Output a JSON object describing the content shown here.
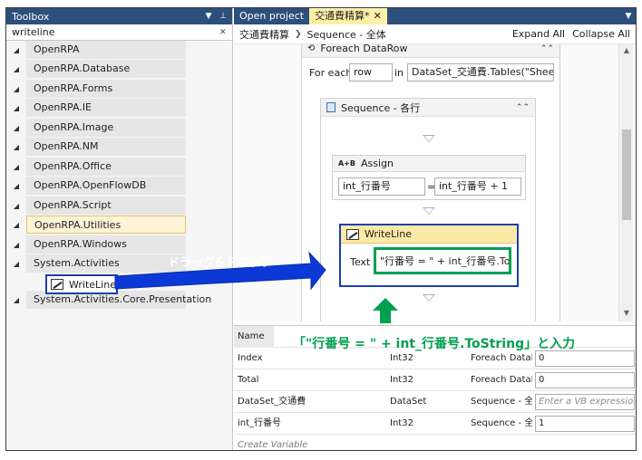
{
  "toolbox": {
    "title": "Toolbox",
    "pin": "▾ ⊥",
    "search_value": "writeline",
    "categories": [
      "OpenRPA",
      "OpenRPA.Database",
      "OpenRPA.Forms",
      "OpenRPA.IE",
      "OpenRPA.Image",
      "OpenRPA.NM",
      "OpenRPA.Office",
      "OpenRPA.OpenFlowDB",
      "OpenRPA.Script",
      "OpenRPA.Utilities",
      "OpenRPA.Windows",
      "System.Activities",
      "System.Activities.Core.Presentation"
    ],
    "tool_item": "WriteLine"
  },
  "tabs": {
    "open_project": "Open project",
    "active": "交通費精算*",
    "active_close": "✕"
  },
  "breadcrumb": {
    "root": "交通費精算",
    "current": "Sequence - 全体",
    "expand_all": "Expand All",
    "collapse_all": "Collapse All"
  },
  "foreach": {
    "title": "Foreach DataRow",
    "for_each_label": "For each",
    "variable": "row",
    "in_label": "in",
    "collection": "DataSet_交通費.Tables(\"Sheet1\")"
  },
  "sequence": {
    "title": "Sequence - 各行"
  },
  "assign": {
    "title": "Assign",
    "icon_text": "A+B",
    "to": "int_行番号",
    "eq": "=",
    "value": "int_行番号 + 1"
  },
  "writeline": {
    "title": "WriteLine",
    "text_label": "Text",
    "text_value": "\"行番号 = \" + int_行番号.ToSt"
  },
  "annotations": {
    "drag_drop": "ドラッグ&ドロップ",
    "instruction": "「\"行番号 = \" + int_行番号.ToString」と入力"
  },
  "variables": {
    "header_name": "Name",
    "rows": [
      {
        "name": "Index",
        "type": "Int32",
        "scope": "Foreach DataI",
        "default": "0",
        "placeholder": false
      },
      {
        "name": "Total",
        "type": "Int32",
        "scope": "Foreach DataI",
        "default": "0",
        "placeholder": false
      },
      {
        "name": "DataSet_交通費",
        "type": "DataSet",
        "scope": "Sequence - 全",
        "default": "Enter a VB expressio.",
        "placeholder": true
      },
      {
        "name": "int_行番号",
        "type": "Int32",
        "scope": "Sequence - 全",
        "default": "1",
        "placeholder": false
      }
    ],
    "create_variable": "Create Variable"
  },
  "colors": {
    "title_bar": "#2d4f7c",
    "active_tab": "#fff0a8",
    "callout_blue": "#1a3fb3",
    "arrow_blue": "#0c39d6",
    "highlight_green": "#00a050",
    "writeline_header": "#fde9a6"
  }
}
